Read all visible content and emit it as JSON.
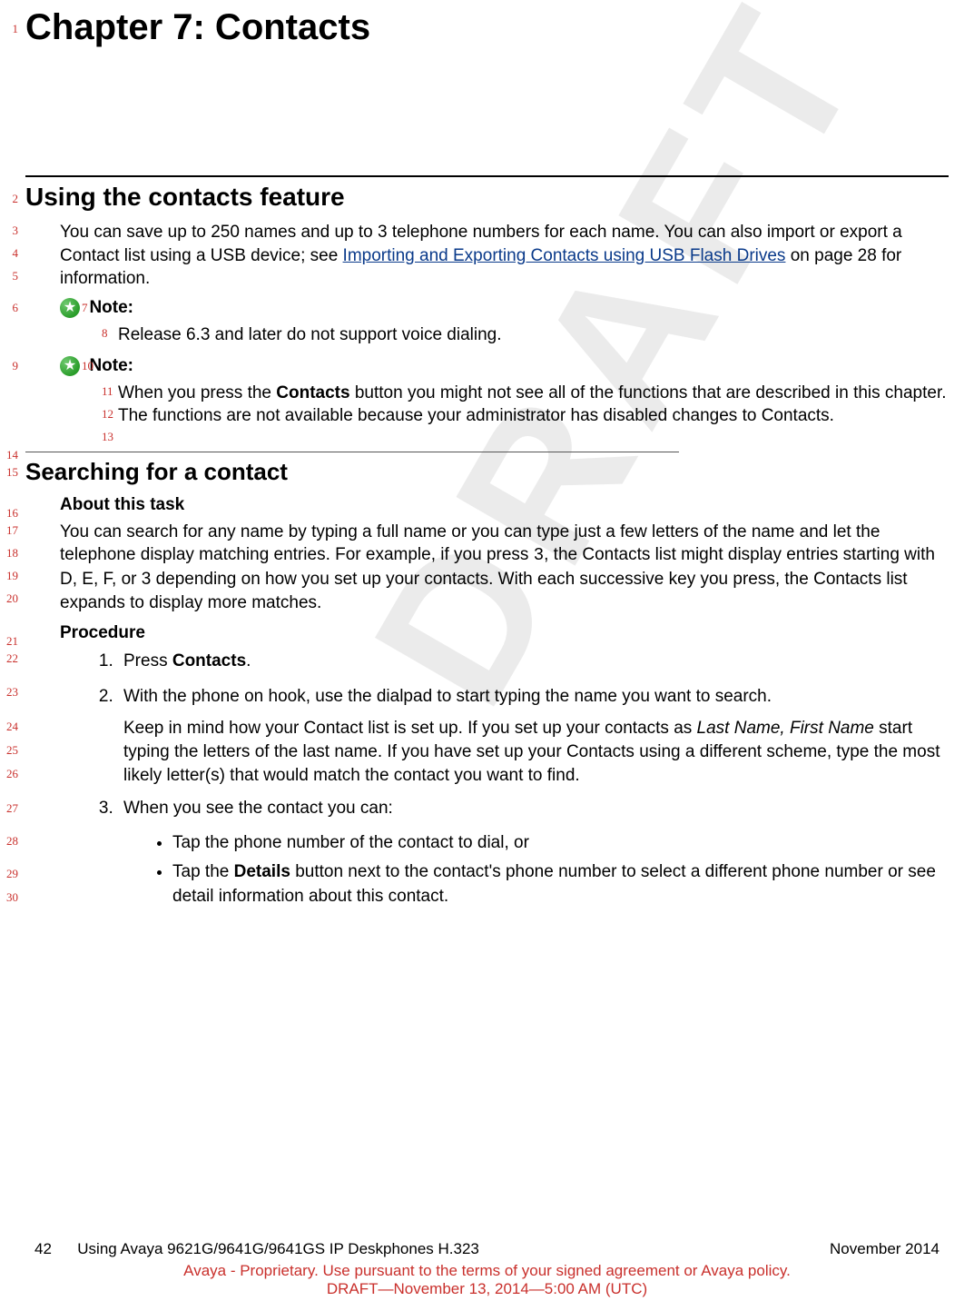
{
  "watermark": "DRAFT",
  "chapter": {
    "title": "Chapter 7:  Contacts"
  },
  "section1": {
    "title": "Using the contacts feature",
    "intro_pre": "You can save up to 250 names and up to 3 telephone numbers for each name. You can also import or export a Contact list using a USB device; see ",
    "intro_link": "Importing and Exporting Contacts using USB Flash Drives",
    "intro_post": " on page 28 for information.",
    "note1_label": "Note:",
    "note1_body": "Release 6.3 and later do not support voice dialing.",
    "note2_label": "Note:",
    "note2_body_pre": "When you press the ",
    "note2_body_bold": "Contacts",
    "note2_body_post": " button you might not see all of the functions that are described in this chapter. The functions are not available because your administrator has disabled changes to Contacts."
  },
  "section2": {
    "title": "Searching for a contact",
    "about_label": "About this task",
    "about_body_pre": "You can search for any name by typing a full name or you can type just a few letters of the name and let the telephone display matching entries. For example, if you press ",
    "about_body_key": "3",
    "about_body_post": ", the Contacts list might display entries starting with D, E, F, or 3 depending on how you set up your contacts. With each successive key you press, the Contacts list expands to display more matches.",
    "procedure_label": "Procedure",
    "step1_pre": "Press ",
    "step1_bold": "Contacts",
    "step1_post": ".",
    "step2": "With the phone on hook, use the dialpad to start typing the name you want to search.",
    "step2_extra_pre": "Keep in mind how your Contact list is set up. If you set up your contacts as ",
    "step2_extra_italic": "Last Name, First Name",
    "step2_extra_post": " start typing the letters of the last name. If you have set up your Contacts using a different scheme, type the most likely letter(s) that would match the contact you want to find.",
    "step3": "When you see the contact you can:",
    "bullet1": "Tap the phone number of the contact to dial, or",
    "bullet2_pre": "Tap the ",
    "bullet2_bold": "Details",
    "bullet2_post": " button next to the contact's phone number to select a different phone number or see detail information about this contact."
  },
  "footer": {
    "page": "42",
    "doc_title": "Using Avaya 9621G/9641G/9641GS IP Deskphones H.323",
    "date": "November 2014",
    "red1": "Avaya - Proprietary. Use pursuant to the terms of your signed agreement or Avaya policy.",
    "red2": "DRAFT—November 13, 2014—5:00 AM (UTC)"
  },
  "line_numbers": [
    "1",
    "2",
    "3",
    "4",
    "5",
    "6",
    "7",
    "8",
    "9",
    "10",
    "11",
    "12",
    "13",
    "14",
    "15",
    "16",
    "17",
    "18",
    "19",
    "20",
    "21",
    "22",
    "23",
    "24",
    "25",
    "26",
    "27",
    "28",
    "29",
    "30"
  ]
}
